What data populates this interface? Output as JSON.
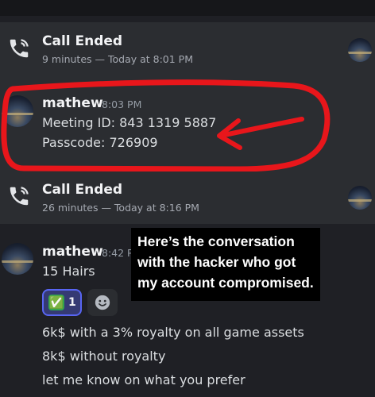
{
  "calls": [
    {
      "title": "Call Ended",
      "subtitle": "9 minutes — Today at 8:01 PM"
    },
    {
      "title": "Call Ended",
      "subtitle": "26 minutes — Today at 8:16 PM"
    }
  ],
  "message1": {
    "author": "mathew",
    "time": "8:03 PM",
    "lines": [
      "Meeting ID: 843 1319 5887",
      "Passcode: 726909"
    ]
  },
  "message2": {
    "author": "mathew",
    "time": "8:42 P",
    "lines": [
      "15 Hairs"
    ],
    "reaction": {
      "emoji": "✅",
      "count": "1"
    },
    "followups": [
      "6k$ with a 3% royalty on all game assets",
      "8k$ without royalty",
      "let me know on what you prefer"
    ]
  },
  "caption": "Here’s the conversation with the hacker who got my account compromised.",
  "colors": {
    "annotation": "#e8161b",
    "caption_bg": "#000000",
    "reaction_border": "#5865f2"
  },
  "icons": [
    "phone-icon",
    "avatar",
    "smiley-icon",
    "check-emoji"
  ]
}
